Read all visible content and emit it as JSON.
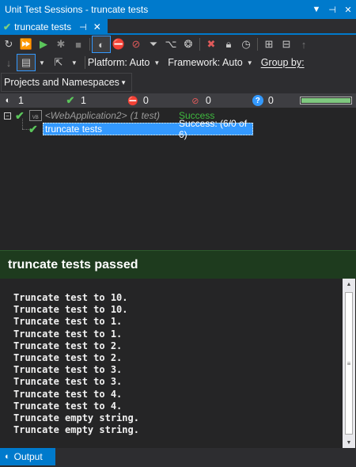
{
  "window": {
    "title": "Unit Test Sessions - truncate tests"
  },
  "tab": {
    "label": "truncate tests"
  },
  "toolbar": {
    "platform_label": "Platform: Auto",
    "framework_label": "Framework: Auto",
    "group_by_label": "Group by:",
    "group_by_value": "Projects and Namespaces"
  },
  "stats": {
    "total": "1",
    "passed": "1",
    "failed": "0",
    "ignored": "0",
    "inconclusive": "0",
    "progress_fraction": 1.0
  },
  "tree": {
    "project_name": "<WebApplication2>",
    "project_count": "(1 test)",
    "project_status": "Success",
    "test_name": "truncate tests",
    "test_status": "Success: (6/0 of 6)"
  },
  "output": {
    "header": "truncate tests passed",
    "lines": [
      "Truncate test to 10.",
      "Truncate test to 10.",
      "Truncate test to 1.",
      "Truncate test to 1.",
      "Truncate test to 2.",
      "Truncate test to 2.",
      "Truncate test to 3.",
      "Truncate test to 3.",
      "Truncate test to 4.",
      "Truncate test to 4.",
      "Truncate empty string.",
      "Truncate empty string."
    ]
  },
  "bottom_tab": {
    "label": "Output"
  },
  "colors": {
    "accent": "#007acc",
    "success": "#3fb93f",
    "pass_header_bg": "#1e3b1e",
    "selection": "#3399ff"
  }
}
